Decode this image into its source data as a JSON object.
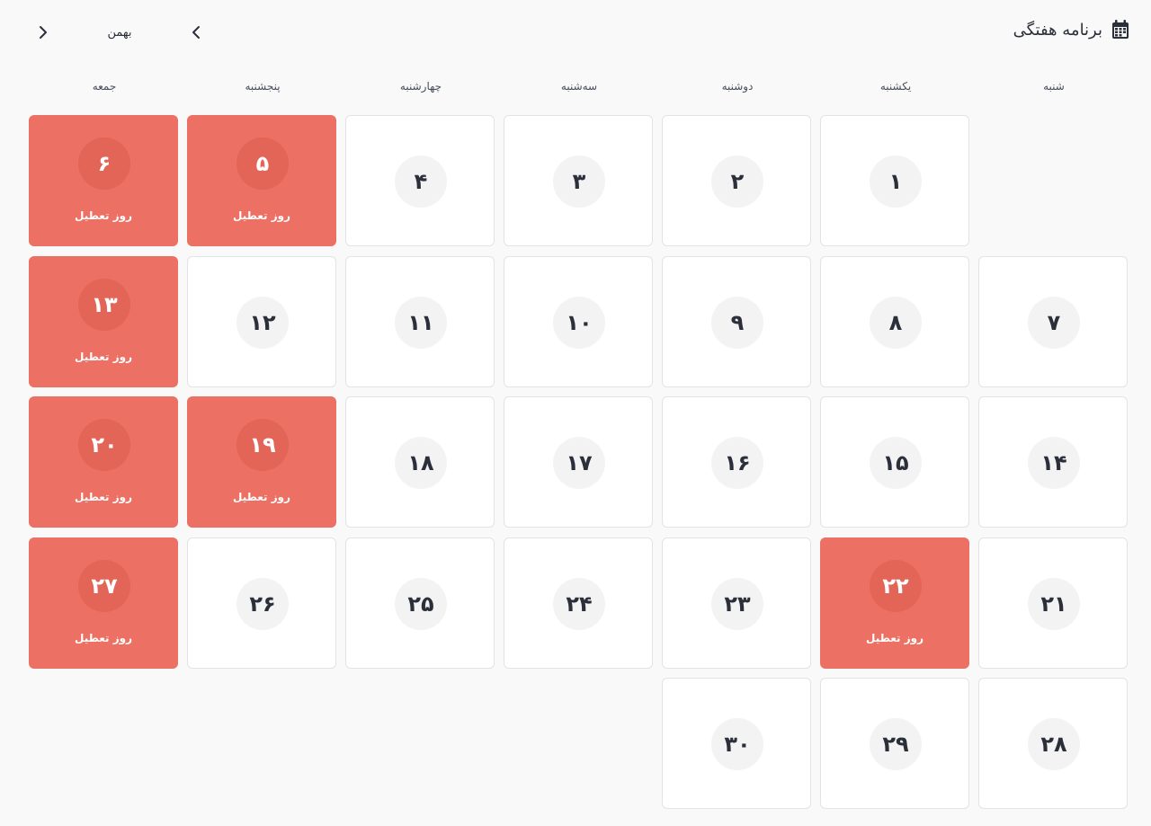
{
  "header": {
    "title": "برنامه هفتگی",
    "icon": "calendar-icon",
    "month": "بهمن",
    "prev_icon": "chevron-left-icon",
    "next_icon": "chevron-right-icon"
  },
  "weekdays": [
    "شنبه",
    "یکشنبه",
    "دوشنبه",
    "سه‌شنبه",
    "چهارشنبه",
    "پنجشنبه",
    "جمعه"
  ],
  "holiday_label": "روز تعطیل",
  "colors": {
    "holiday": "#ec7063",
    "holiday_circle": "#e26558",
    "day_bg": "#ffffff",
    "circle_bg": "#f3f3f4",
    "text": "#2b2f3a",
    "page_bg": "#f9f9f9"
  },
  "first_weekday_index": 1,
  "days": [
    {
      "num": "۱",
      "holiday": false
    },
    {
      "num": "۲",
      "holiday": false
    },
    {
      "num": "۳",
      "holiday": false
    },
    {
      "num": "۴",
      "holiday": false
    },
    {
      "num": "۵",
      "holiday": true
    },
    {
      "num": "۶",
      "holiday": true
    },
    {
      "num": "۷",
      "holiday": false
    },
    {
      "num": "۸",
      "holiday": false
    },
    {
      "num": "۹",
      "holiday": false
    },
    {
      "num": "۱۰",
      "holiday": false
    },
    {
      "num": "۱۱",
      "holiday": false
    },
    {
      "num": "۱۲",
      "holiday": false
    },
    {
      "num": "۱۳",
      "holiday": true
    },
    {
      "num": "۱۴",
      "holiday": false
    },
    {
      "num": "۱۵",
      "holiday": false
    },
    {
      "num": "۱۶",
      "holiday": false
    },
    {
      "num": "۱۷",
      "holiday": false
    },
    {
      "num": "۱۸",
      "holiday": false
    },
    {
      "num": "۱۹",
      "holiday": true
    },
    {
      "num": "۲۰",
      "holiday": true
    },
    {
      "num": "۲۱",
      "holiday": false
    },
    {
      "num": "۲۲",
      "holiday": true
    },
    {
      "num": "۲۳",
      "holiday": false
    },
    {
      "num": "۲۴",
      "holiday": false
    },
    {
      "num": "۲۵",
      "holiday": false
    },
    {
      "num": "۲۶",
      "holiday": false
    },
    {
      "num": "۲۷",
      "holiday": true
    },
    {
      "num": "۲۸",
      "holiday": false
    },
    {
      "num": "۲۹",
      "holiday": false
    },
    {
      "num": "۳۰",
      "holiday": false
    }
  ]
}
